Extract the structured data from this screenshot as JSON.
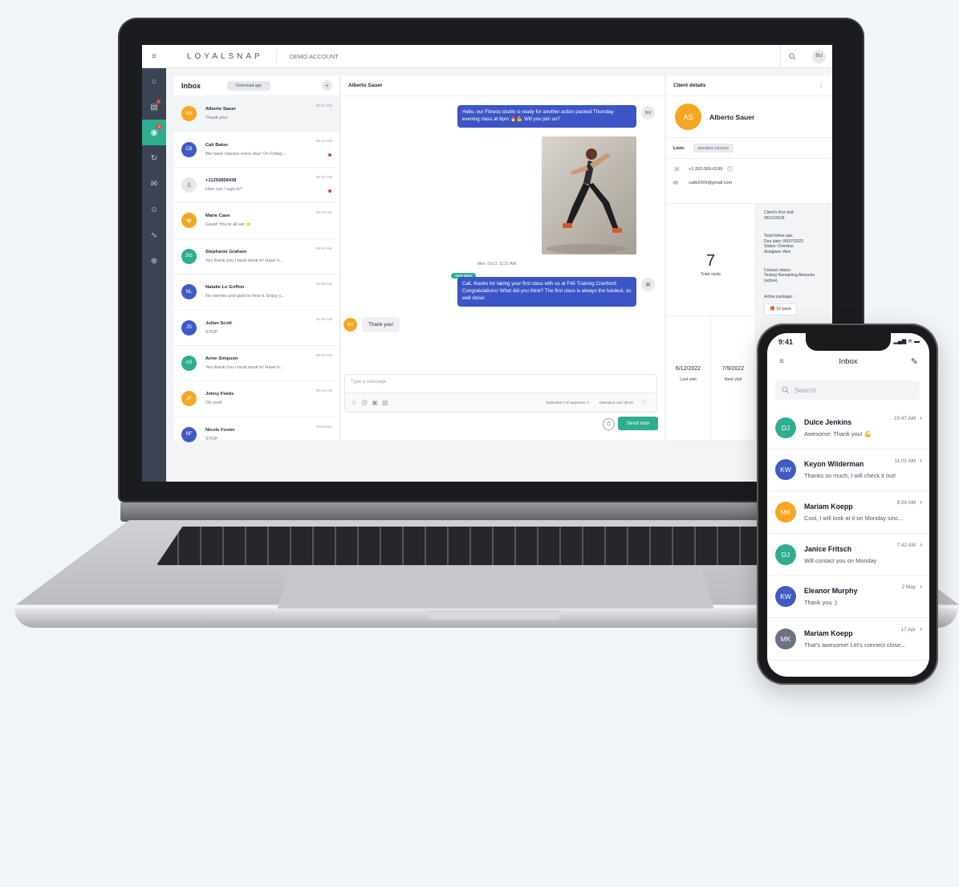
{
  "app": {
    "brand": "LOYALSNAP",
    "account": "DEMO ACCOUNT",
    "user_initials": "SU"
  },
  "colors": {
    "accent": "#2eae8f",
    "sidebar": "#3c4453",
    "bubble": "#3b55c6",
    "orange": "#f5a623",
    "blue": "#3f5bc4",
    "teal": "#2eae8f",
    "gray": "#6b7280"
  },
  "inbox": {
    "title": "Inbox",
    "download_label": "Download app",
    "add_label": "+",
    "items": [
      {
        "initials": "AS",
        "name": "Alberto Sauer",
        "preview": "Thank you!",
        "time": "05:23 PM",
        "color": "#f5a623",
        "unread": false
      },
      {
        "initials": "CB",
        "name": "Cali Baker",
        "preview": "We have classes every day! On Friday,...",
        "time": "05:23 PM",
        "color": "#3f5bc4",
        "unread": true
      },
      {
        "initials": "",
        "name": "+11292858438",
        "preview": "How can I sign in?",
        "time": "08:31 AM",
        "color": "#e5e7eb",
        "unread": true
      },
      {
        "initials": "",
        "name": "Marie Case",
        "preview": "Great! You're all set ⭐",
        "time": "09:03 AM",
        "color": "#f5a623",
        "unread": false
      },
      {
        "initials": "SG",
        "name": "Stephanie Graham",
        "preview": "Yes thank you I must book in! Have h...",
        "time": "08:00 AM",
        "color": "#2eae8f",
        "unread": false
      },
      {
        "initials": "NL",
        "name": "Natalie Le Griffon",
        "preview": "No worries and glad to hear it. Enjoy y...",
        "time": "03:39 AM",
        "color": "#3f5bc4",
        "unread": false
      },
      {
        "initials": "JS",
        "name": "Julian Scott",
        "preview": "STOP",
        "time": "11:53 AM",
        "color": "#3f5bc4",
        "unread": false
      },
      {
        "initials": "AS",
        "name": "Anne Simpson",
        "preview": "Yes thank you I must book in! Have h...",
        "time": "08:00 AM",
        "color": "#2eae8f",
        "unread": false
      },
      {
        "initials": "JF",
        "name": "Johny Fields",
        "preview": "Ok cool!",
        "time": "09:03 AM",
        "color": "#f5a623",
        "unread": false
      },
      {
        "initials": "NF",
        "name": "Nicole Foster",
        "preview": "STOP",
        "time": "Yesterday",
        "color": "#3f5bc4",
        "unread": false
      }
    ]
  },
  "conversation": {
    "contact": "Alberto Sauer",
    "msg1": "Hello, our Fitness studio is ready for another action packed Thursday evening class at 6pm 🔥💪 Will you join us?",
    "msg1_initials": "SU",
    "timestamp": "Mon, Oct 2, 11:21 AM",
    "blast_tag": "SMS Blast",
    "msg2": "Cali, thanks for taking your first class with us at F45 Training Cranford! Congratulations! What did you think? The first class is always the hardest, so well done!",
    "reply": "Thank you!",
    "reply_initials": "SU",
    "placeholder": "Type a message",
    "segments_label": "Estimated # of segments: 0",
    "cost_label": "Estimated cost: $0.00",
    "send_label": "Send now"
  },
  "client": {
    "header": "Client details",
    "initials": "AS",
    "name": "Alberto Sauer",
    "lists_label": "Lists:",
    "list_chip": "Members 14/11/23",
    "phone": "+1-202-555-0199",
    "email": "calib2009@gmail.com",
    "visits_count": "7",
    "visits_label": "Total visits",
    "last_visit": "6/12/2022",
    "last_visit_label": "Last visit",
    "next_visit": "7/9/2022",
    "next_visit_label": "Next visit",
    "first_visit_label": "Client's first visit:",
    "first_visit": "08/12/2018",
    "followups_label": "Total follow-ups:",
    "due_date": "Due date: 06/07/2023",
    "status": "Status: Overdue",
    "assignee": "Assignee: Alex",
    "contact_status_label": "Contact status:",
    "contact_status": "Testing Remaining Amounts (active)",
    "package_label": "Active package:",
    "package": "10-pack"
  },
  "phone": {
    "time": "9:41",
    "title": "Inbox",
    "search_placeholder": "Search",
    "items": [
      {
        "initials": "DJ",
        "name": "Dulce Jenkins",
        "preview": "Awesome. Thank you! 💪",
        "time": "10:47 AM",
        "color": "#2eae8f"
      },
      {
        "initials": "KW",
        "name": "Keyon Wilderman",
        "preview": "Thanks so much, I will check it out!",
        "time": "11:02 AM",
        "color": "#3f5bc4"
      },
      {
        "initials": "MK",
        "name": "Mariam Koepp",
        "preview": "Cool, I will look at it  on Monday sinc...",
        "time": "9:29 AM",
        "color": "#f5a623"
      },
      {
        "initials": "DJ",
        "name": "Janice Fritsch",
        "preview": "Will contact you on Monday",
        "time": "7:42 AM",
        "color": "#2eae8f"
      },
      {
        "initials": "KW",
        "name": "Eleanor Murphy",
        "preview": "Thank you :)",
        "time": "2 May",
        "color": "#3f5bc4"
      },
      {
        "initials": "MK",
        "name": "Mariam Koepp",
        "preview": "That's awesome! Let's connect close...",
        "time": "17 Apr",
        "color": "#6b7280"
      }
    ]
  }
}
